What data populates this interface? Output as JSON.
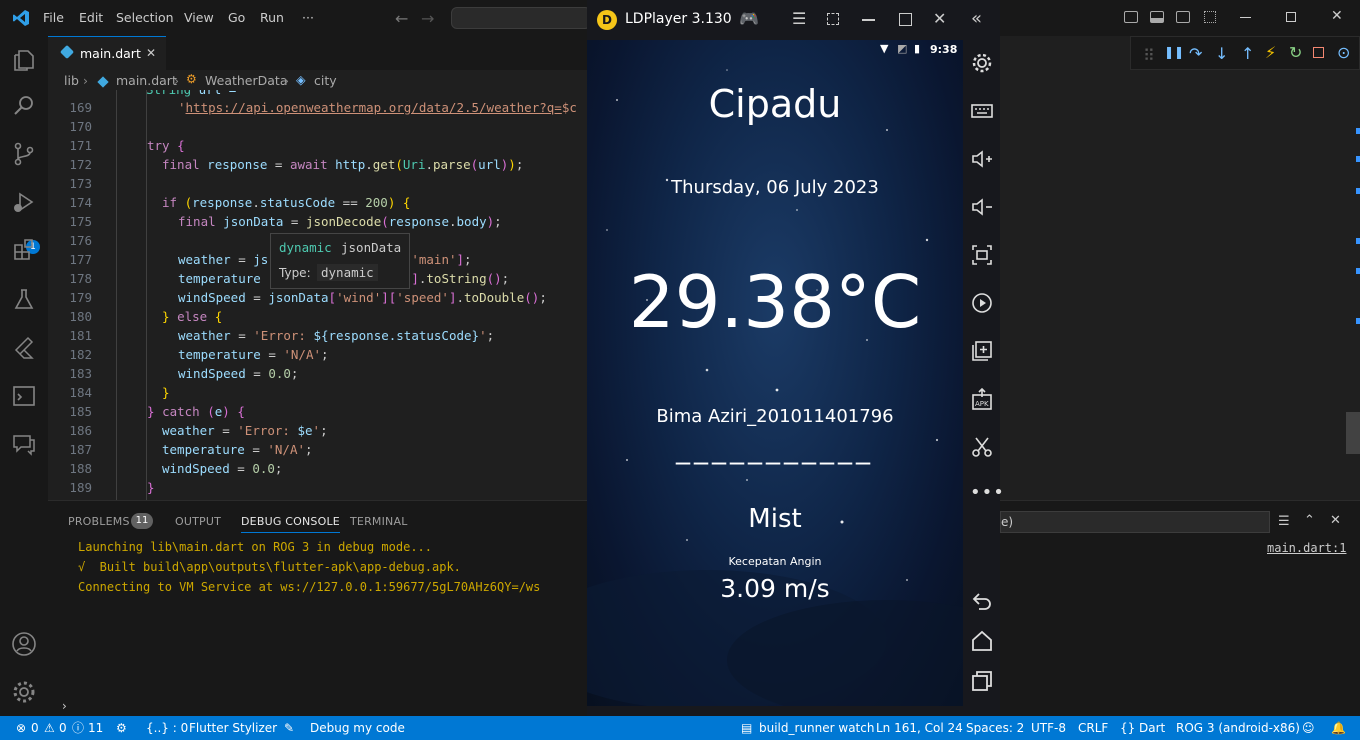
{
  "menu": [
    "File",
    "Edit",
    "Selection",
    "View",
    "Go",
    "Run",
    "···"
  ],
  "tab": {
    "label": "main.dart",
    "close": "✕"
  },
  "breadcrumb": {
    "p1": "lib",
    "p2": "main.dart",
    "p3": "WeatherData",
    "p4": "city"
  },
  "editor": {
    "top_fragment": "String url =",
    "lines": [
      {
        "n": "169"
      },
      {
        "n": "170"
      },
      {
        "n": "171"
      },
      {
        "n": "172"
      },
      {
        "n": "173"
      },
      {
        "n": "174"
      },
      {
        "n": "175"
      },
      {
        "n": "176"
      },
      {
        "n": "177"
      },
      {
        "n": "178"
      },
      {
        "n": "179"
      },
      {
        "n": "180"
      },
      {
        "n": "181"
      },
      {
        "n": "182"
      },
      {
        "n": "183"
      },
      {
        "n": "184"
      },
      {
        "n": "185"
      },
      {
        "n": "186"
      },
      {
        "n": "187"
      },
      {
        "n": "188"
      },
      {
        "n": "189"
      }
    ],
    "hover": {
      "line1_kw": "dynamic",
      "line1_name": "jsonData",
      "line2_label": "Type:",
      "line2_type": "dynamic"
    }
  },
  "panel": {
    "tabs": [
      "PROBLEMS",
      "OUTPUT",
      "DEBUG CONSOLE",
      "TERMINAL"
    ],
    "problems_count": "11",
    "console": [
      "Launching lib\\main.dart on ROG 3 in debug mode...",
      "√  Built build\\app\\outputs\\flutter-apk\\app-debug.apk.",
      "Connecting to VM Service at ws://127.0.0.1:59677/5gL70AHz6QY=/ws"
    ],
    "source_link": "main.dart:1",
    "filter_fragment": "e)"
  },
  "emulator": {
    "title": "LDPlayer 3.130",
    "phone_status": {
      "time": "9:38"
    },
    "city": "Cipadu",
    "date": "Thursday, 06 July 2023",
    "temperature": "29.38°C",
    "author": "Bima Aziri_201011401796",
    "divider": "___________",
    "weather": "Mist",
    "wind_label": "Kecepatan Angin",
    "wind_value": "3.09 m/s"
  },
  "statusbar": {
    "errors": "0",
    "warnings": "0",
    "info": "11",
    "braces": "{..} : 0",
    "stylizer": "Flutter Stylizer",
    "debug": "Debug my code",
    "build": "build_runner watch",
    "position": "Ln 161, Col 24",
    "spaces": "Spaces: 2",
    "encoding": "UTF-8",
    "eol": "CRLF",
    "language": "Dart",
    "device": "ROG 3 (android-x86)"
  },
  "colors": {
    "accent": "#0078d4",
    "status": "#0078d4",
    "bg": "#1f1f1f"
  }
}
